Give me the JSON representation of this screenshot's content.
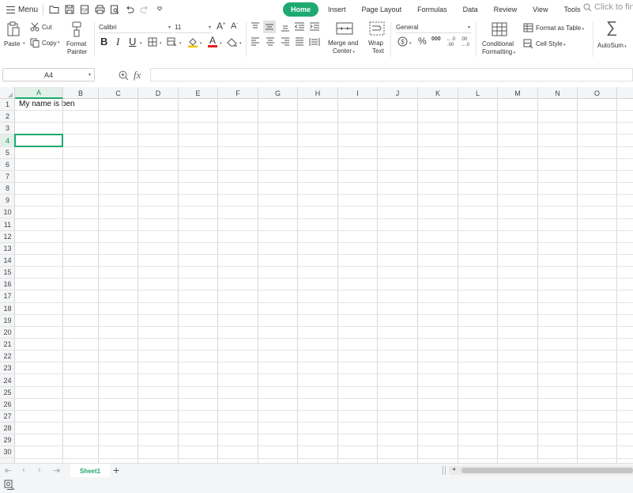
{
  "menubar": {
    "menu_label": "Menu",
    "tabs": [
      {
        "label": "Home",
        "active": true
      },
      {
        "label": "Insert"
      },
      {
        "label": "Page Layout"
      },
      {
        "label": "Formulas"
      },
      {
        "label": "Data"
      },
      {
        "label": "Review"
      },
      {
        "label": "View"
      },
      {
        "label": "Tools"
      }
    ],
    "search_placeholder": "Click to fin"
  },
  "ribbon": {
    "paste": "Paste",
    "cut": "Cut",
    "copy": "Copy",
    "format_painter_1": "Format",
    "format_painter_2": "Painter",
    "font_name": "Calibri",
    "font_size": "11",
    "bold": "B",
    "italic": "I",
    "underline": "U",
    "merge_1": "Merge and",
    "merge_2": "Center",
    "wrap_1": "Wrap",
    "wrap_2": "Text",
    "number_format": "General",
    "percent": "%",
    "thousands": "000",
    "conditional_1": "Conditional",
    "conditional_2": "Formatting",
    "format_as_table": "Format as Table",
    "cell_style": "Cell Style",
    "autosum": "AutoSum",
    "font_grow": "A",
    "font_shrink": "A",
    "font_color": "A"
  },
  "formula_bar": {
    "name_box": "A4",
    "fx_label": "fx",
    "formula": ""
  },
  "grid": {
    "columns": [
      "A",
      "B",
      "C",
      "D",
      "E",
      "F",
      "G",
      "H",
      "I",
      "J",
      "K",
      "L",
      "M",
      "N",
      "O"
    ],
    "rows": [
      "1",
      "2",
      "3",
      "4",
      "5",
      "6",
      "7",
      "8",
      "9",
      "10",
      "11",
      "12",
      "13",
      "14",
      "15",
      "16",
      "17",
      "18",
      "19",
      "20",
      "21",
      "22",
      "23",
      "24",
      "25",
      "26",
      "27",
      "28",
      "29",
      "30"
    ],
    "selected_cell": "A4",
    "cells": {
      "A1": "My name is ben"
    }
  },
  "sheets": {
    "tabs": [
      "Sheet1"
    ],
    "active": "Sheet1"
  },
  "colors": {
    "accent": "#1fa971",
    "grid_line": "#d9d9d9",
    "header_bg": "#f4f5f7",
    "font_color_bar": "#e02020",
    "fill_color_bar": "#f5c400"
  }
}
